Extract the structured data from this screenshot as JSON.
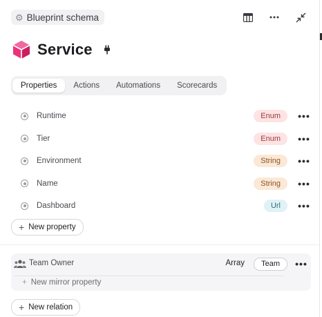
{
  "header": {
    "schema_label": "Blueprint schema",
    "title": "Service"
  },
  "tabs": [
    {
      "label": "Properties",
      "active": true
    },
    {
      "label": "Actions",
      "active": false
    },
    {
      "label": "Automations",
      "active": false
    },
    {
      "label": "Scorecards",
      "active": false
    }
  ],
  "properties": [
    {
      "name": "Runtime",
      "type": "Enum"
    },
    {
      "name": "Tier",
      "type": "Enum"
    },
    {
      "name": "Environment",
      "type": "String"
    },
    {
      "name": "Name",
      "type": "String"
    },
    {
      "name": "Dashboard",
      "type": "Url"
    }
  ],
  "buttons": {
    "new_property": "New property",
    "new_relation": "New relation",
    "new_mirror_property": "New mirror property",
    "more": "•••"
  },
  "relation": {
    "name": "Team Owner",
    "kind": "Array",
    "target": "Team"
  },
  "colors": {
    "accent_pink": "#e8347a",
    "enum_badge": "#fde3e3",
    "string_badge": "#fbe8d6",
    "url_badge": "#dff2f5"
  }
}
